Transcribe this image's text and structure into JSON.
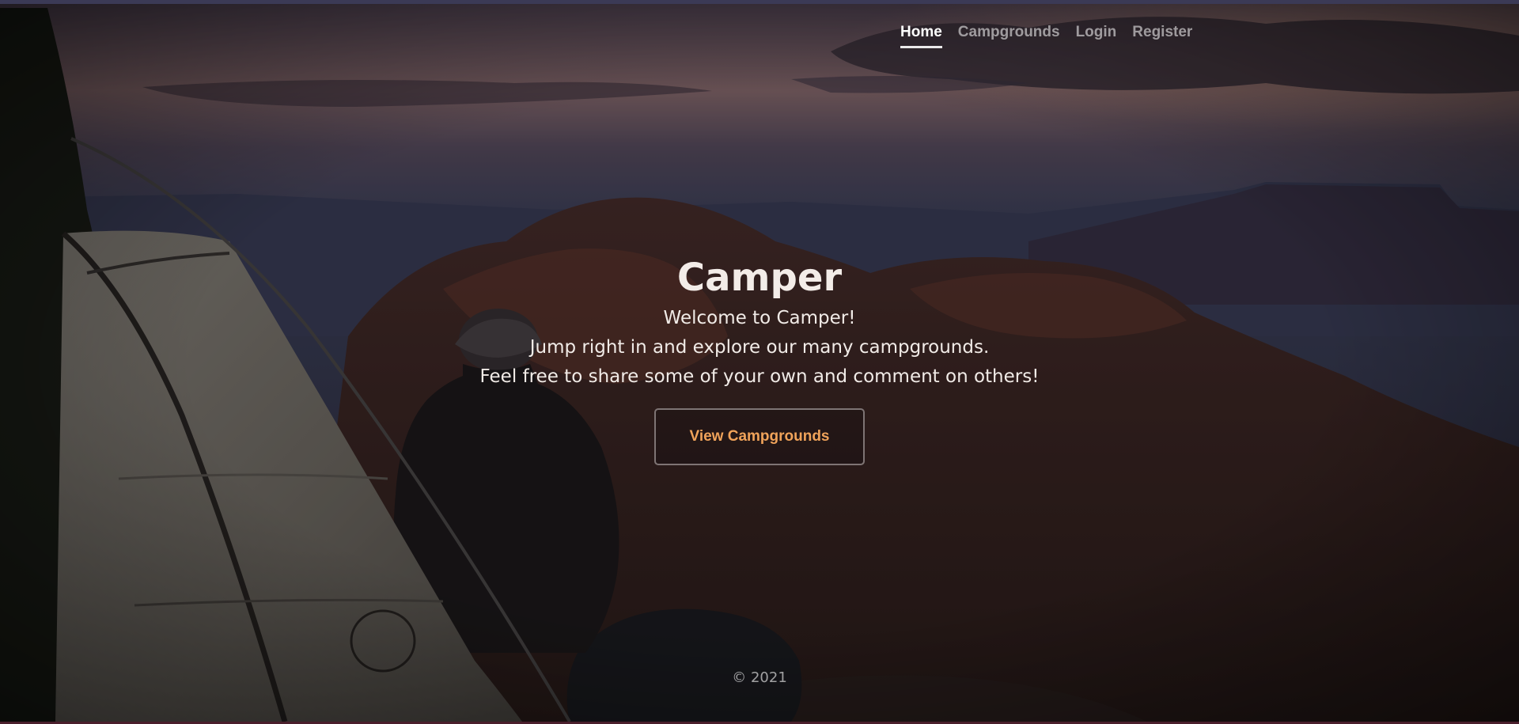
{
  "nav": {
    "items": [
      {
        "label": "Home",
        "active": true
      },
      {
        "label": "Campgrounds",
        "active": false
      },
      {
        "label": "Login",
        "active": false
      },
      {
        "label": "Register",
        "active": false
      }
    ]
  },
  "hero": {
    "title": "Camper",
    "lines": [
      "Welcome to Camper!",
      "Jump right in and explore our many campgrounds.",
      "Feel free to share some of your own and comment on others!"
    ],
    "button_label": "View Campgrounds"
  },
  "footer": {
    "text": "© 2021"
  },
  "colors": {
    "accent": "#f0a35a",
    "nav_active": "#ffffff",
    "nav_inactive": "#9a9494",
    "top_strip": "#3b3a56",
    "bottom_strip": "#4a1f2c"
  }
}
